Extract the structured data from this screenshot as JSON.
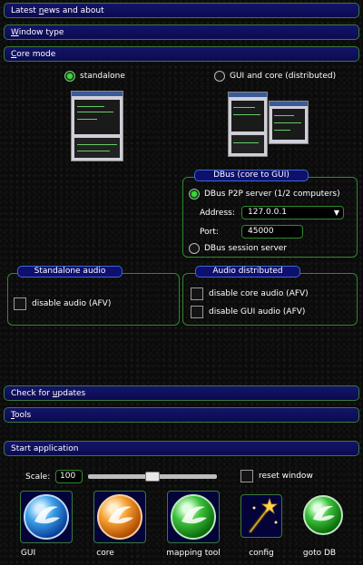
{
  "sections": {
    "news": {
      "pre": "Latest ",
      "ul": "n",
      "post": "ews and about"
    },
    "window_type": {
      "pre": "",
      "ul": "W",
      "post": "indow type"
    },
    "core_mode": {
      "pre": "",
      "ul": "C",
      "post": "ore mode"
    },
    "updates": {
      "pre": "Check for ",
      "ul": "u",
      "post": "pdates"
    },
    "tools": {
      "pre": "",
      "ul": "T",
      "post": "ools"
    },
    "start": {
      "pre": "Start application",
      "ul": "",
      "post": ""
    }
  },
  "core_mode": {
    "standalone_label": "standalone",
    "distributed_label": "GUI and core (distributed)",
    "standalone_selected": true
  },
  "dbus": {
    "title": "DBus (core to GUI)",
    "p2p_label": "DBus P2P server (1/2 computers)",
    "address_label": "Address:",
    "address_value": "127.0.0.1",
    "port_label": "Port:",
    "port_value": "45000",
    "session_label": "DBus session server",
    "p2p_selected": true
  },
  "standalone_audio": {
    "title": "Standalone audio",
    "disable_label": "disable audio (AFV)",
    "disable_checked": false
  },
  "audio_distributed": {
    "title": "Audio distributed",
    "disable_core_label": "disable core audio (AFV)",
    "disable_gui_label": "disable GUI audio (AFV)",
    "disable_core_checked": false,
    "disable_gui_checked": false
  },
  "start": {
    "scale_label": "Scale:",
    "scale_value": "100",
    "scale_fraction": 0.5,
    "reset_label": "reset window",
    "reset_checked": false,
    "buttons": [
      "GUI",
      "core",
      "mapping tool",
      "config",
      "goto DB"
    ]
  },
  "colors": {
    "accent_green": "#33dd33",
    "bar_blue": "#0f0f6e",
    "border_green": "#2e8a2e"
  }
}
